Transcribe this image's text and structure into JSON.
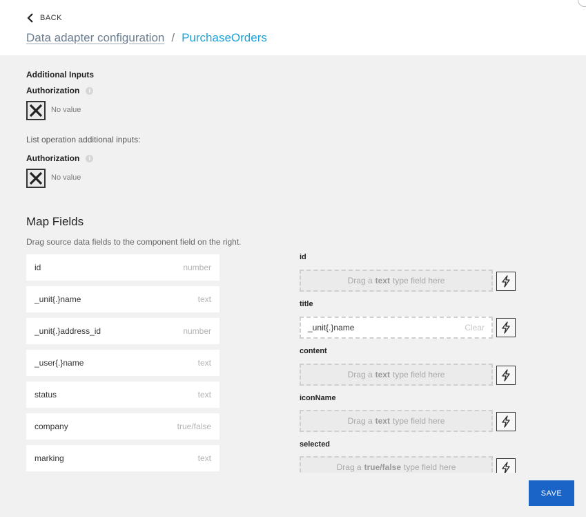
{
  "header": {
    "back_label": "BACK",
    "breadcrumb_link": "Data adapter configuration",
    "breadcrumb_sep": "/",
    "breadcrumb_current": "PurchaseOrders"
  },
  "additional_inputs": {
    "title": "Additional Inputs",
    "auth_label": "Authorization",
    "no_value": "No value"
  },
  "list_inputs": {
    "title": "List operation additional inputs:",
    "auth_label": "Authorization",
    "no_value": "No value"
  },
  "map_fields": {
    "title": "Map Fields",
    "subtitle": "Drag source data fields to the component field on the right.",
    "sources": [
      {
        "name": "id",
        "type": "number"
      },
      {
        "name": "_unit{.}name",
        "type": "text"
      },
      {
        "name": "_unit{.}address_id",
        "type": "number"
      },
      {
        "name": "_user{.}name",
        "type": "text"
      },
      {
        "name": "status",
        "type": "text"
      },
      {
        "name": "company",
        "type": "true/false"
      },
      {
        "name": "marking",
        "type": "text"
      }
    ],
    "targets": [
      {
        "label": "id",
        "drop_pre": "Drag a",
        "drop_type": "text",
        "drop_post": "type field here"
      },
      {
        "label": "title",
        "value": "_unit{.}name",
        "clear": "Clear"
      },
      {
        "label": "content",
        "drop_pre": "Drag a",
        "drop_type": "text",
        "drop_post": "type field here"
      },
      {
        "label": "iconName",
        "drop_pre": "Drag a",
        "drop_type": "text",
        "drop_post": "type field here"
      },
      {
        "label": "selected",
        "drop_pre": "Drag a",
        "drop_type": "true/false",
        "drop_post": "type field here"
      }
    ]
  },
  "actions": {
    "save_label": "SAVE"
  }
}
